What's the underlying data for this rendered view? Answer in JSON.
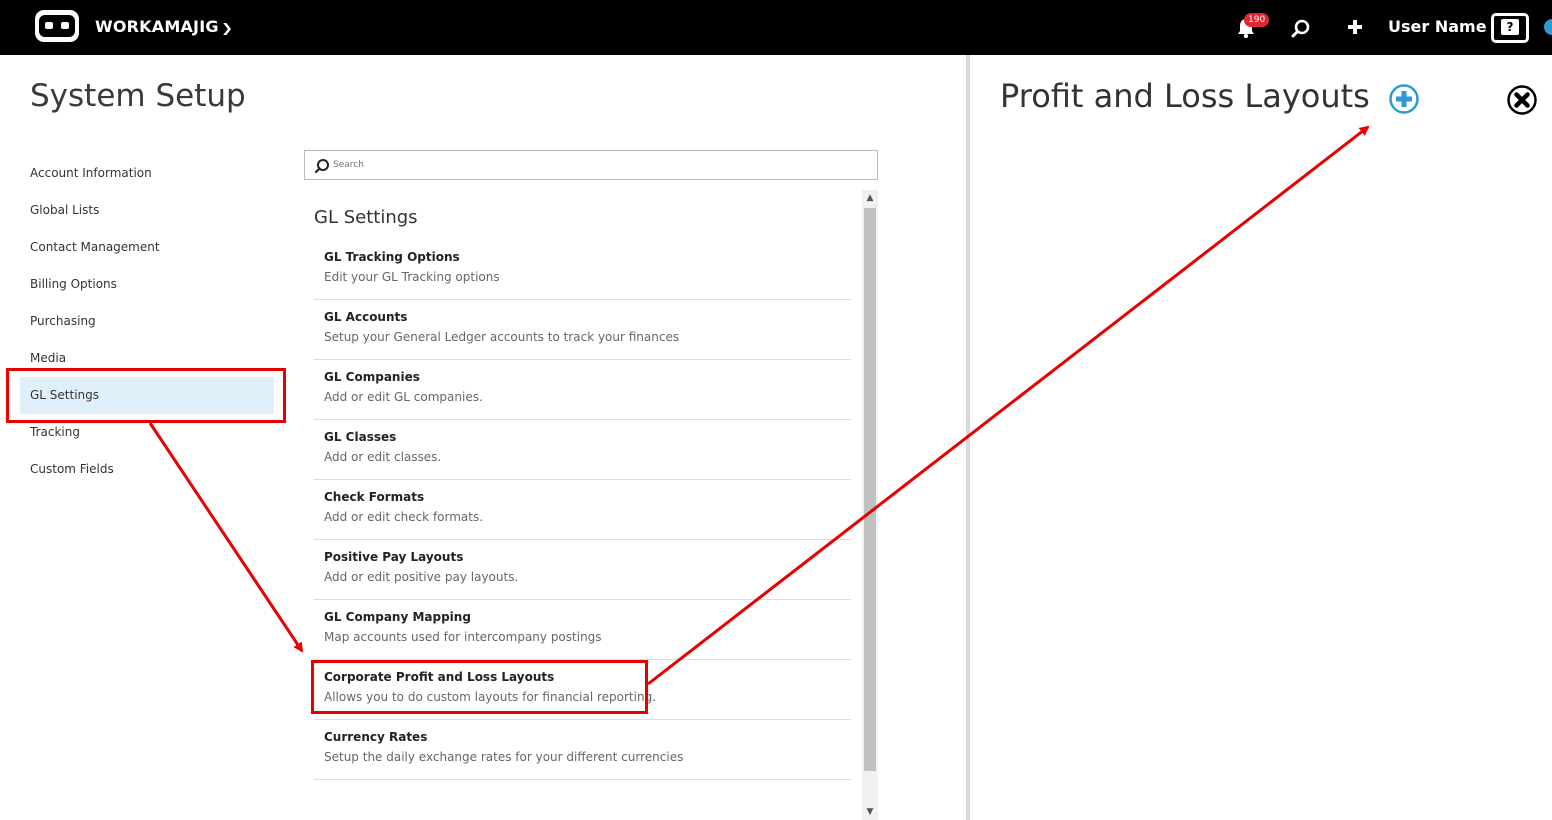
{
  "topbar": {
    "brand": "WORKAMAJIG",
    "notification_count": "190",
    "user_name": "User Name",
    "help_label": "?",
    "icons": [
      "logo-icon",
      "chevron-down-icon",
      "bell-icon",
      "search-icon",
      "plus-icon",
      "help-icon"
    ]
  },
  "page": {
    "title": "System Setup"
  },
  "sidebar": {
    "items": [
      {
        "label": "Account Information"
      },
      {
        "label": "Global Lists"
      },
      {
        "label": "Contact Management"
      },
      {
        "label": "Billing Options"
      },
      {
        "label": "Purchasing"
      },
      {
        "label": "Media"
      },
      {
        "label": "GL Settings",
        "active": true
      },
      {
        "label": "Tracking"
      },
      {
        "label": "Custom Fields"
      }
    ]
  },
  "search": {
    "placeholder": "Search"
  },
  "section": {
    "title": "GL Settings",
    "rows": [
      {
        "title": "GL Tracking Options",
        "desc": "Edit your GL Tracking options"
      },
      {
        "title": "GL Accounts",
        "desc": "Setup your General Ledger accounts to track your finances"
      },
      {
        "title": "GL Companies",
        "desc": "Add or edit GL companies."
      },
      {
        "title": "GL Classes",
        "desc": "Add or edit classes."
      },
      {
        "title": "Check Formats",
        "desc": "Add or edit check formats."
      },
      {
        "title": "Positive Pay Layouts",
        "desc": "Add or edit positive pay layouts."
      },
      {
        "title": "GL Company Mapping",
        "desc": "Map accounts used for intercompany postings"
      },
      {
        "title": "Corporate Profit and Loss Layouts",
        "desc": "Allows you to do custom layouts for financial reporting."
      },
      {
        "title": "Currency Rates",
        "desc": "Setup the daily exchange rates for your different currencies"
      }
    ]
  },
  "panel": {
    "title": "Profit and Loss Layouts"
  },
  "colors": {
    "topbar": "#000000",
    "accent": "#2d9ad6",
    "active_bg": "#e0f0fa",
    "annotation": "#e60000",
    "badge": "#e3262f"
  }
}
